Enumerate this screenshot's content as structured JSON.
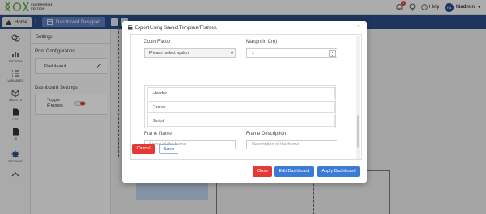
{
  "brand": {
    "edition_line1": "ENTERPRISE",
    "edition_line2": "EDITION"
  },
  "topbar": {
    "notification_count": "9",
    "help_label": "Help",
    "avatar_initials": "HA",
    "user_name": "hiadmin"
  },
  "breadcrumb": {
    "home_label": "Home",
    "current_label": "Dashboard Designer"
  },
  "sidebar": {
    "items": [
      {
        "label": "",
        "icon": "layers-icon"
      },
      {
        "label": "REPORTS",
        "icon": "bar-chart-icon"
      },
      {
        "label": "VARIABLES",
        "icon": "list-icon"
      },
      {
        "label": "OBJECTS",
        "icon": "cube-icon"
      },
      {
        "label": "CSS",
        "icon": "css-file-icon"
      },
      {
        "label": "JS",
        "icon": "js-file-icon"
      },
      {
        "label": "SETTINGS",
        "icon": "gear-icon"
      },
      {
        "label": "",
        "icon": "chevron-up-icon"
      }
    ]
  },
  "panel": {
    "title": "Settings",
    "print_config_label": "Print Configuration",
    "dashboard_label": "Dashboard",
    "dashboard_settings_label": "Dashboard Settings",
    "toggle_label_1": "Toggle",
    "toggle_label_2": "iFrames"
  },
  "modal": {
    "title": "Export Using Saved Template/Frames.",
    "zoom_label": "Zoom Factor",
    "zoom_value": "Please select option",
    "margin_label": "Margin(in Cm)",
    "margin_value": "1",
    "frames": [
      "Header",
      "Footer",
      "Script"
    ],
    "frame_name_label": "Frame Name",
    "frame_name_placeholder": "Name of the frame",
    "frame_desc_label": "Frame Description",
    "frame_desc_placeholder": "Description of the frame",
    "cancel_label": "Cancel",
    "save_label": "Save",
    "close_label": "Close",
    "edit_label": "Edit Dashboard",
    "apply_label": "Apply Dashboard"
  },
  "colors": {
    "primary": "#2b4d86",
    "danger": "#e53935",
    "action": "#3b7bd4"
  }
}
